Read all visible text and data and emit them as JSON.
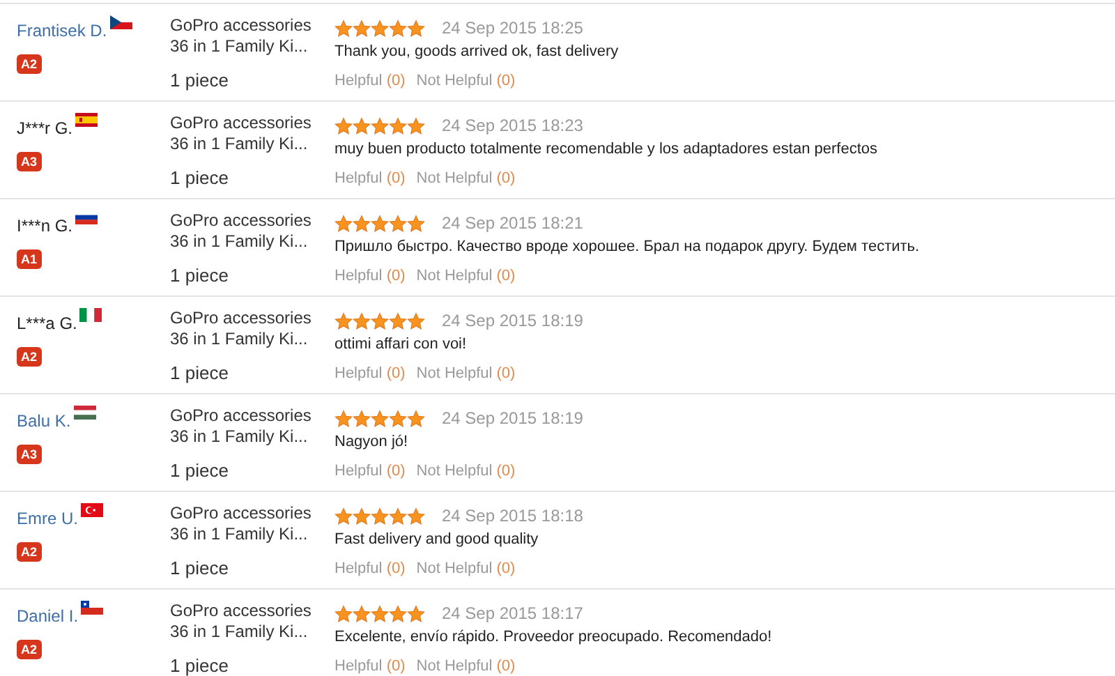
{
  "reviews": [
    {
      "name": "Frantisek D.",
      "linked": true,
      "flag": {
        "kind": "cz"
      },
      "badge": "A2",
      "product": "GoPro accessories 36 in 1 Family Ki...",
      "quantity": "1 piece",
      "stars": 5,
      "date": "24 Sep 2015 18:25",
      "text": "Thank you, goods arrived ok, fast delivery",
      "helpful": {
        "label": "Helpful",
        "count": "(0)"
      },
      "not_helpful": {
        "label": "Not Helpful",
        "count": "(0)"
      }
    },
    {
      "name": "J***r G.",
      "linked": false,
      "flag": {
        "kind": "es"
      },
      "badge": "A3",
      "product": "GoPro accessories 36 in 1 Family Ki...",
      "quantity": "1 piece",
      "stars": 5,
      "date": "24 Sep 2015 18:23",
      "text": "muy buen producto totalmente recomendable y los adaptadores estan perfectos",
      "helpful": {
        "label": "Helpful",
        "count": "(0)"
      },
      "not_helpful": {
        "label": "Not Helpful",
        "count": "(0)"
      }
    },
    {
      "name": "I***n G.",
      "linked": false,
      "flag": {
        "kind": "ru"
      },
      "badge": "A1",
      "product": "GoPro accessories 36 in 1 Family Ki...",
      "quantity": "1 piece",
      "stars": 5,
      "date": "24 Sep 2015 18:21",
      "text": "Пришло быстро. Качество вроде хорошее. Брал на подарок другу. Будем тестить.",
      "helpful": {
        "label": "Helpful",
        "count": "(0)"
      },
      "not_helpful": {
        "label": "Not Helpful",
        "count": "(0)"
      }
    },
    {
      "name": "L***a G.",
      "linked": false,
      "flag": {
        "kind": "it"
      },
      "badge": "A2",
      "product": "GoPro accessories 36 in 1 Family Ki...",
      "quantity": "1 piece",
      "stars": 5,
      "date": "24 Sep 2015 18:19",
      "text": "ottimi affari con voi!",
      "helpful": {
        "label": "Helpful",
        "count": "(0)"
      },
      "not_helpful": {
        "label": "Not Helpful",
        "count": "(0)"
      }
    },
    {
      "name": "Balu K.",
      "linked": true,
      "flag": {
        "kind": "hu"
      },
      "badge": "A3",
      "product": "GoPro accessories 36 in 1 Family Ki...",
      "quantity": "1 piece",
      "stars": 5,
      "date": "24 Sep 2015 18:19",
      "text": "Nagyon jó!",
      "helpful": {
        "label": "Helpful",
        "count": "(0)"
      },
      "not_helpful": {
        "label": "Not Helpful",
        "count": "(0)"
      }
    },
    {
      "name": "Emre U.",
      "linked": true,
      "flag": {
        "kind": "tr"
      },
      "badge": "A2",
      "product": "GoPro accessories 36 in 1 Family Ki...",
      "quantity": "1 piece",
      "stars": 5,
      "date": "24 Sep 2015 18:18",
      "text": "Fast delivery and good quality",
      "helpful": {
        "label": "Helpful",
        "count": "(0)"
      },
      "not_helpful": {
        "label": "Not Helpful",
        "count": "(0)"
      }
    },
    {
      "name": "Daniel I.",
      "linked": true,
      "flag": {
        "kind": "cl"
      },
      "badge": "A2",
      "product": "GoPro accessories 36 in 1 Family Ki...",
      "quantity": "1 piece",
      "stars": 5,
      "date": "24 Sep 2015 18:17",
      "text": "Excelente, envío rápido. Proveedor preocupado. Recomendado!",
      "helpful": {
        "label": "Helpful",
        "count": "(0)"
      },
      "not_helpful": {
        "label": "Not Helpful",
        "count": "(0)"
      }
    }
  ]
}
